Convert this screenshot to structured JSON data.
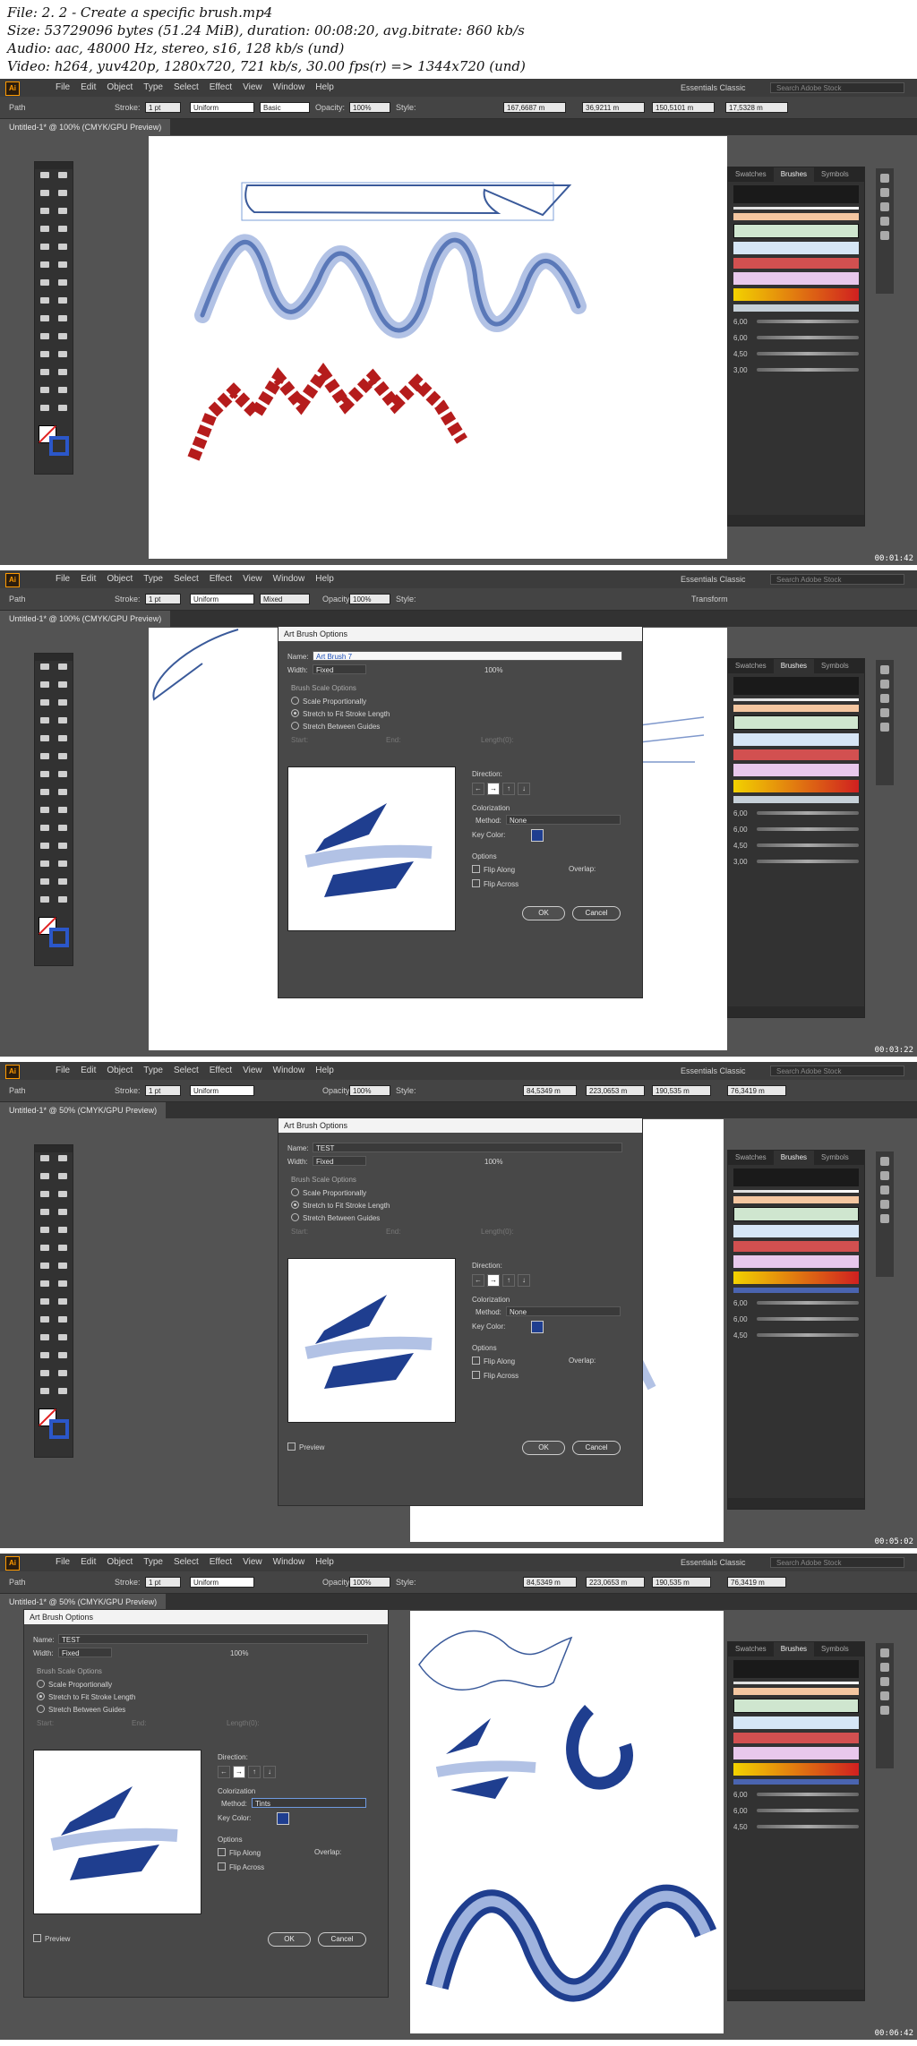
{
  "header": {
    "line1": "File: 2. 2 - Create a specific brush.mp4",
    "line2": "Size: 53729096 bytes (51.24 MiB), duration: 00:08:20, avg.bitrate: 860 kb/s",
    "line3": "Audio: aac, 48000 Hz, stereo, s16, 128 kb/s (und)",
    "line4": "Video: h264, yuv420p, 1280x720, 721 kb/s, 30.00 fps(r) => 1344x720 (und)"
  },
  "app": {
    "logo": "Ai",
    "menus": [
      "File",
      "Edit",
      "Object",
      "Type",
      "Select",
      "Effect",
      "View",
      "Window",
      "Help"
    ],
    "workspace": "Essentials Classic",
    "search_placeholder": "Search Adobe Stock",
    "path_label": "Path",
    "stroke_label": "Stroke:",
    "stroke_value": "1 pt",
    "uniform_label": "Uniform",
    "basic_label": "Basic",
    "opacity_label": "Opacity:",
    "opacity_value": "100%",
    "style_label": "Style:",
    "transform_label": "Transform",
    "mixed_label": "Mixed"
  },
  "panel_tabs": [
    "Swatches",
    "Brushes",
    "Symbols"
  ],
  "brush_sizes": [
    "6,00",
    "6,00",
    "4,50",
    "3,00"
  ],
  "frames": [
    {
      "tab": "Untitled-1* @ 100% (CMYK/GPU Preview)",
      "timestamp": "00:01:42",
      "x_coord": "167,6687 m",
      "y_coord": "36,9211 m",
      "w_coord": "150,5101 m",
      "h_coord": "17,5328 m"
    },
    {
      "tab": "Untitled-1* @ 100% (CMYK/GPU Preview)",
      "timestamp": "00:03:22"
    },
    {
      "tab": "Untitled-1* @ 50% (CMYK/GPU Preview)",
      "timestamp": "00:05:02",
      "x_coord": "84,5349 m",
      "y_coord": "223,0653 m",
      "w_coord": "190,535 m",
      "h_coord": "76,3419 m"
    },
    {
      "tab": "Untitled-1* @ 50% (CMYK/GPU Preview)",
      "timestamp": "00:06:42",
      "x_coord": "84,5349 m",
      "y_coord": "223,0653 m",
      "w_coord": "190,535 m",
      "h_coord": "76,3419 m"
    }
  ],
  "dialog": {
    "title": "Art Brush Options",
    "name_label": "Name:",
    "name_value_1": "Art Brush 7",
    "name_value_2": "TEST",
    "width_label": "Width:",
    "width_value": "Fixed",
    "width_percent": "100%",
    "scale_options_label": "Brush Scale Options",
    "scale_proportionally": "Scale Proportionally",
    "stretch_to_fit": "Stretch to Fit Stroke Length",
    "stretch_between": "Stretch Between Guides",
    "start_label": "Start:",
    "end_label": "End:",
    "length_label": "Length(0):",
    "direction_label": "Direction:",
    "colorization_label": "Colorization",
    "method_label": "Method:",
    "method_none": "None",
    "method_tints": "Tints",
    "key_color_label": "Key Color:",
    "options_label": "Options",
    "flip_along": "Flip Along",
    "flip_across": "Flip Across",
    "overlap_label": "Overlap:",
    "preview_label": "Preview",
    "ok": "OK",
    "cancel": "Cancel"
  },
  "colors": {
    "brush_blue": "#1f3e8f",
    "app_bg": "#535353",
    "accent_red": "#b51c1c"
  }
}
